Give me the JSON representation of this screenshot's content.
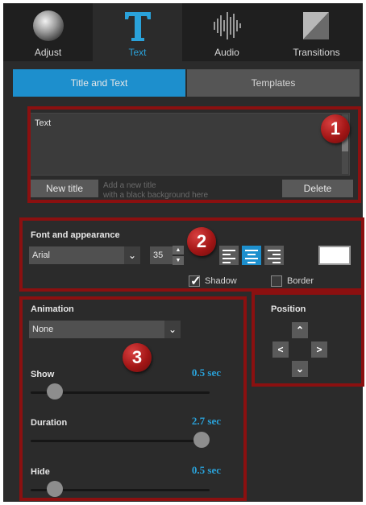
{
  "tabs": [
    {
      "label": "Adjust",
      "icon": "sphere-icon",
      "active": false
    },
    {
      "label": "Text",
      "icon": "text-icon",
      "active": true
    },
    {
      "label": "Audio",
      "icon": "waveform-icon",
      "active": false
    },
    {
      "label": "Transitions",
      "icon": "transition-icon",
      "active": false
    }
  ],
  "subtabs": {
    "title_and_text": "Title and Text",
    "templates": "Templates"
  },
  "text_section": {
    "text_value": "Text",
    "new_title": "New title",
    "hint": "Add a new title\nwith a black background here",
    "delete": "Delete"
  },
  "font": {
    "heading": "Font and appearance",
    "family": "Arial",
    "size": "35",
    "alignment": "center",
    "color": "#ffffff",
    "shadow_label": "Shadow",
    "shadow_checked": true,
    "border_label": "Border",
    "border_checked": false
  },
  "animation": {
    "heading": "Animation",
    "value": "None",
    "sliders": [
      {
        "label": "Show",
        "value": "0.5 sec",
        "fraction": 0.1
      },
      {
        "label": "Duration",
        "value": "2.7 sec",
        "fraction": 1.0
      },
      {
        "label": "Hide",
        "value": "0.5 sec",
        "fraction": 0.1
      }
    ]
  },
  "position": {
    "heading": "Position"
  },
  "callouts": [
    "1",
    "2",
    "3"
  ],
  "colors": {
    "accent": "#1d8fcd",
    "callout": "#8b1010",
    "panel": "#2b2b2b"
  }
}
